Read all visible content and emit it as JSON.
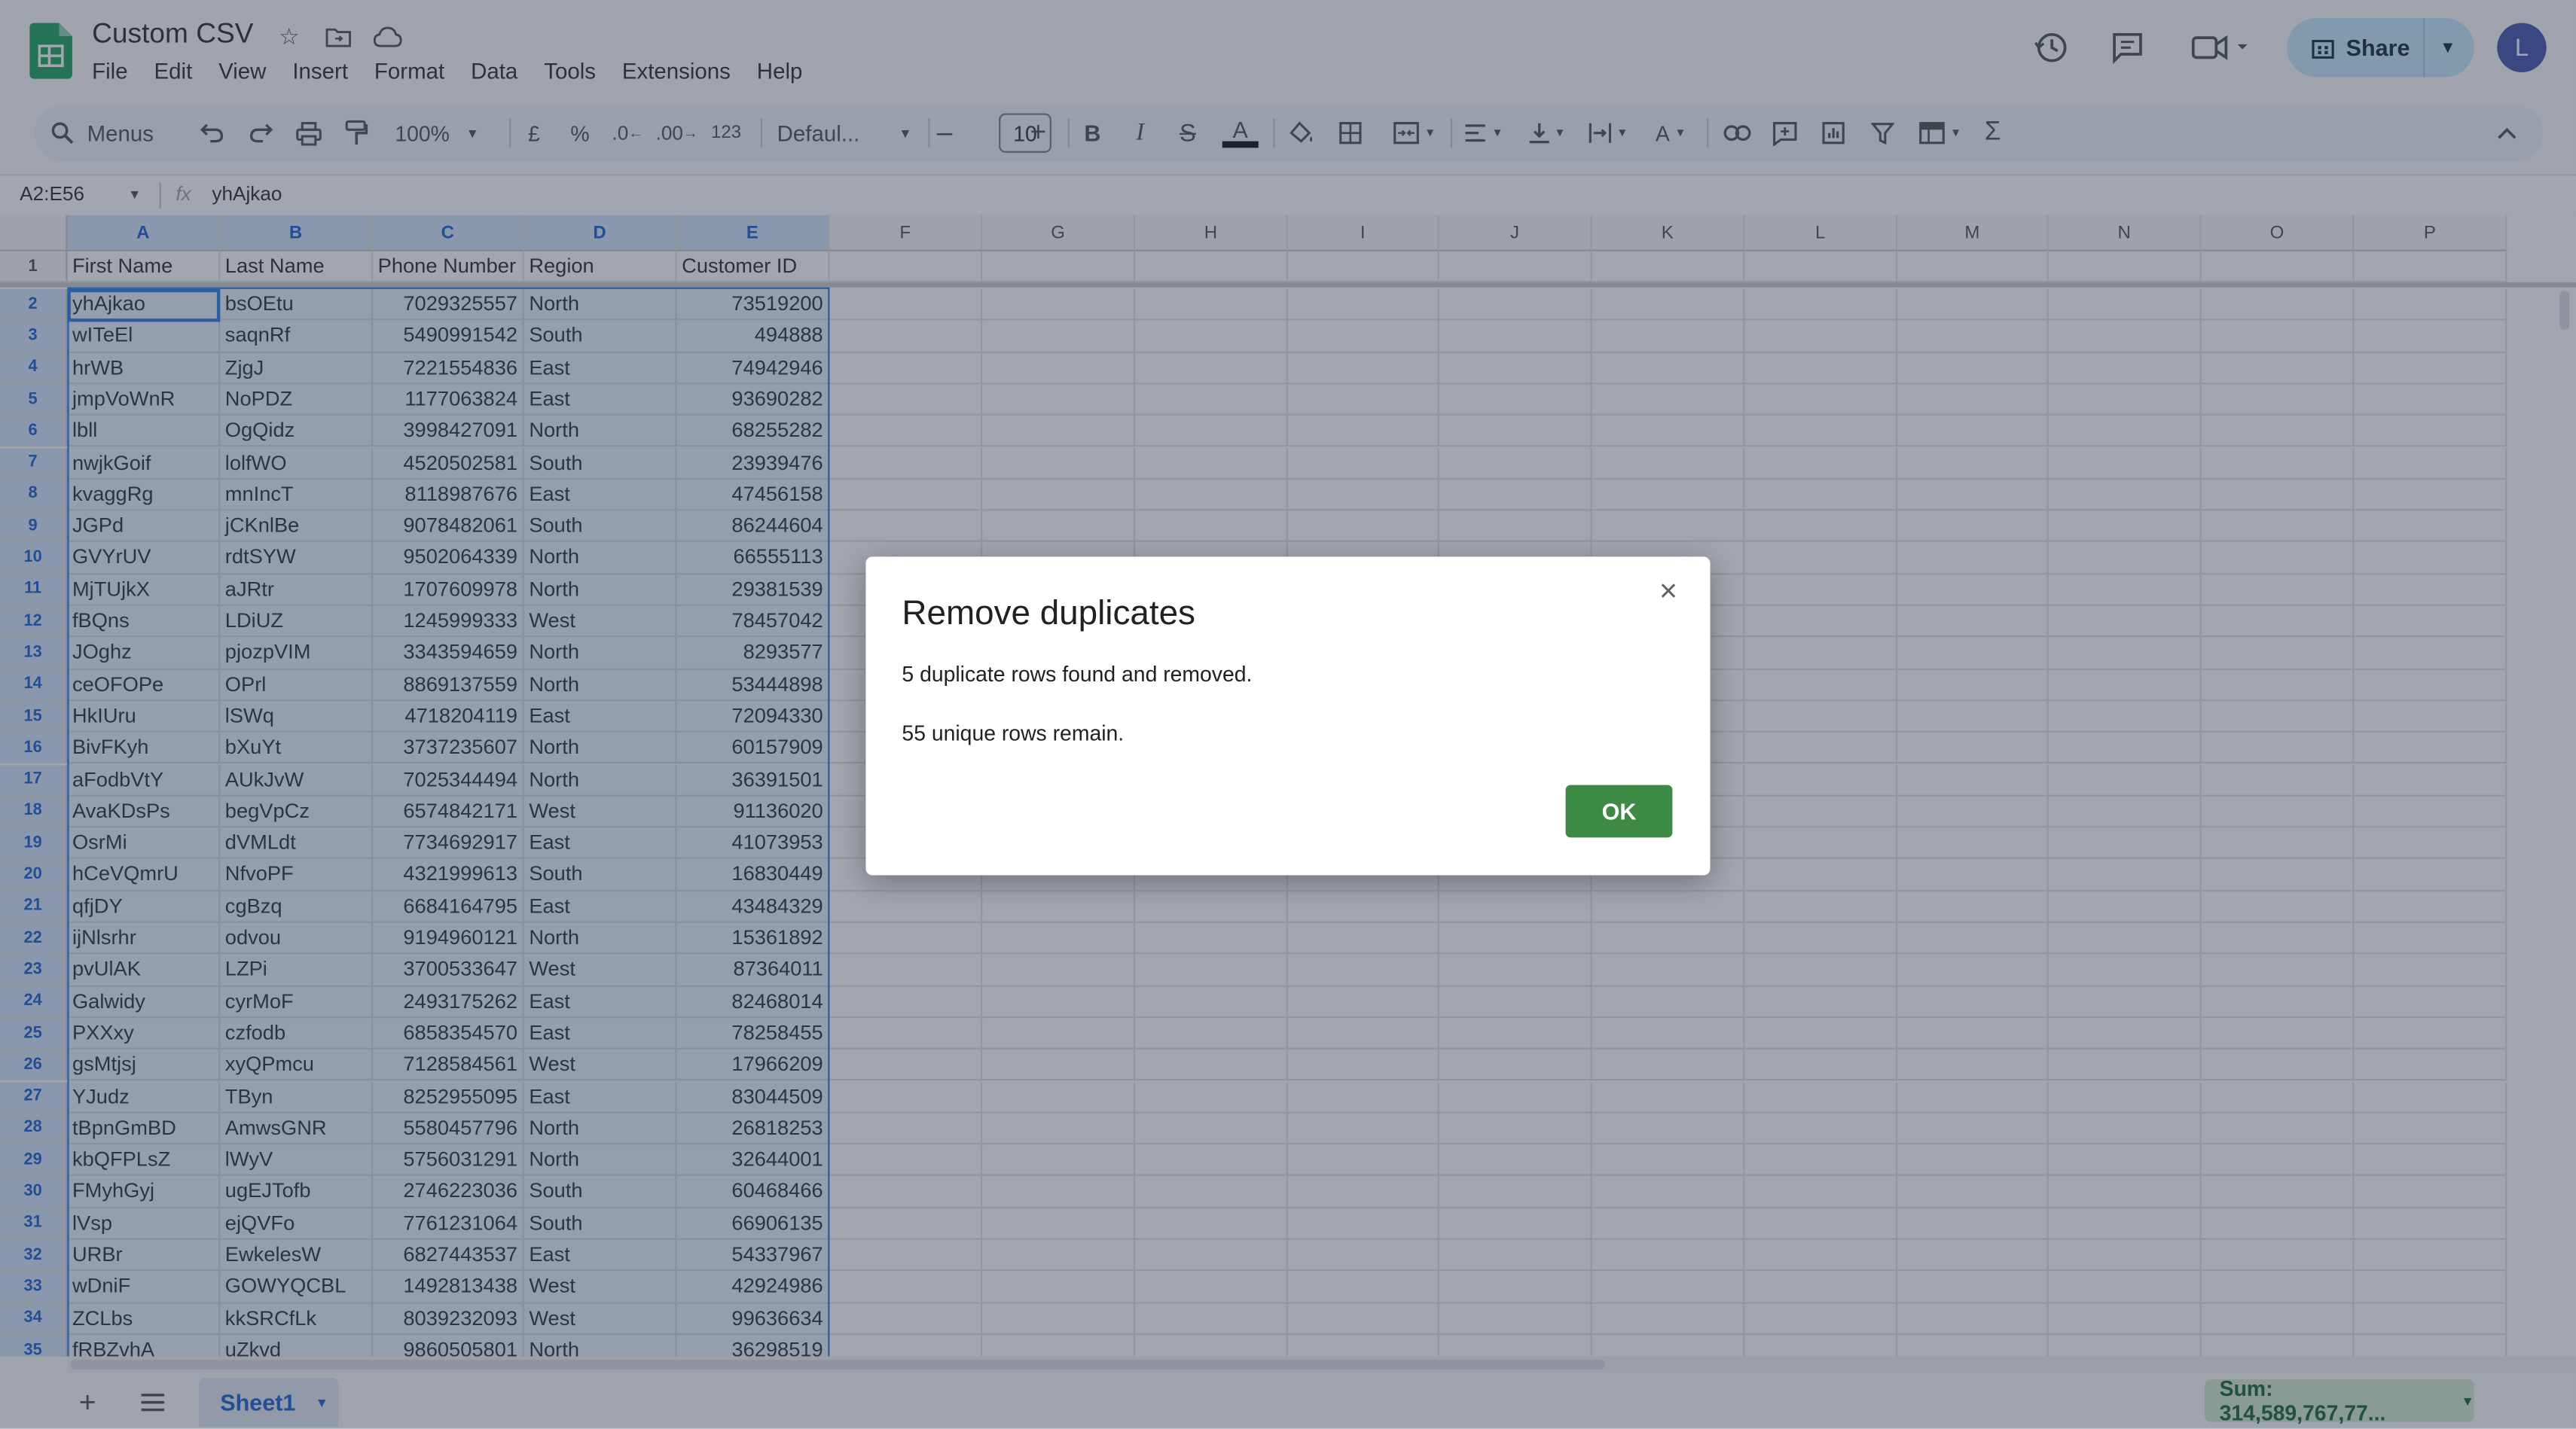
{
  "app": {
    "doc_title": "Custom CSV",
    "menus": [
      "File",
      "Edit",
      "View",
      "Insert",
      "Format",
      "Data",
      "Tools",
      "Extensions",
      "Help"
    ],
    "share_label": "Share",
    "avatar_initial": "L",
    "accent": "#0b57d0"
  },
  "toolbar": {
    "search_label": "Menus",
    "zoom": "100%",
    "currency": "£",
    "percent": "%",
    "dec_decrease": ".0",
    "dec_increase": ".00",
    "format_123": "123",
    "font": "Defaul...",
    "font_size": "10",
    "bold": "B",
    "italic": "I",
    "strike": "S",
    "text_color": "A"
  },
  "formula_bar": {
    "name_box": "A2:E56",
    "fx": "fx",
    "value": "yhAjkao"
  },
  "grid": {
    "columns": [
      "A",
      "B",
      "C",
      "D",
      "E",
      "F",
      "G",
      "H",
      "I",
      "J",
      "K",
      "L",
      "M",
      "N",
      "O",
      "P"
    ],
    "header_row": [
      "First Name",
      "Last Name",
      "Phone Number",
      "Region",
      "Customer ID"
    ],
    "rows": [
      [
        "2",
        "yhAjkao",
        "bsOEtu",
        "7029325557",
        "North",
        "73519200"
      ],
      [
        "3",
        "wITeEl",
        "saqnRf",
        "5490991542",
        "South",
        "494888"
      ],
      [
        "4",
        "hrWB",
        "ZjgJ",
        "7221554836",
        "East",
        "74942946"
      ],
      [
        "5",
        "jmpVoWnR",
        "NoPDZ",
        "1177063824",
        "East",
        "93690282"
      ],
      [
        "6",
        "lbll",
        "OgQidz",
        "3998427091",
        "North",
        "68255282"
      ],
      [
        "7",
        "nwjkGoif",
        "lolfWO",
        "4520502581",
        "South",
        "23939476"
      ],
      [
        "8",
        "kvaggRg",
        "mnIncT",
        "8118987676",
        "East",
        "47456158"
      ],
      [
        "9",
        "JGPd",
        "jCKnlBe",
        "9078482061",
        "South",
        "86244604"
      ],
      [
        "10",
        "GVYrUV",
        "rdtSYW",
        "9502064339",
        "North",
        "66555113"
      ],
      [
        "11",
        "MjTUjkX",
        "aJRtr",
        "1707609978",
        "North",
        "29381539"
      ],
      [
        "12",
        "fBQns",
        "LDiUZ",
        "1245999333",
        "West",
        "78457042"
      ],
      [
        "13",
        "JOghz",
        "pjozpVIM",
        "3343594659",
        "North",
        "8293577"
      ],
      [
        "14",
        "ceOFOPe",
        "OPrl",
        "8869137559",
        "North",
        "53444898"
      ],
      [
        "15",
        "HkIUru",
        "lSWq",
        "4718204119",
        "East",
        "72094330"
      ],
      [
        "16",
        "BivFKyh",
        "bXuYt",
        "3737235607",
        "North",
        "60157909"
      ],
      [
        "17",
        "aFodbVtY",
        "AUkJvW",
        "7025344494",
        "North",
        "36391501"
      ],
      [
        "18",
        "AvaKDsPs",
        "begVpCz",
        "6574842171",
        "West",
        "91136020"
      ],
      [
        "19",
        "OsrMi",
        "dVMLdt",
        "7734692917",
        "East",
        "41073953"
      ],
      [
        "20",
        "hCeVQmrU",
        "NfvoPF",
        "4321999613",
        "South",
        "16830449"
      ],
      [
        "21",
        "qfjDY",
        "cgBzq",
        "6684164795",
        "East",
        "43484329"
      ],
      [
        "22",
        "ijNlsrhr",
        "odvou",
        "9194960121",
        "North",
        "15361892"
      ],
      [
        "23",
        "pvUlAK",
        "LZPi",
        "3700533647",
        "West",
        "87364011"
      ],
      [
        "24",
        "Galwidy",
        "cyrMoF",
        "2493175262",
        "East",
        "82468014"
      ],
      [
        "25",
        "PXXxy",
        "czfodb",
        "6858354570",
        "East",
        "78258455"
      ],
      [
        "26",
        "gsMtjsj",
        "xyQPmcu",
        "7128584561",
        "West",
        "17966209"
      ],
      [
        "27",
        "YJudz",
        "TByn",
        "8252955095",
        "East",
        "83044509"
      ],
      [
        "28",
        "tBpnGmBD",
        "AmwsGNR",
        "5580457796",
        "North",
        "26818253"
      ],
      [
        "29",
        "kbQFPLsZ",
        "lWyV",
        "5756031291",
        "North",
        "32644001"
      ],
      [
        "30",
        "FMyhGyj",
        "ugEJTofb",
        "2746223036",
        "South",
        "60468466"
      ],
      [
        "31",
        "lVsp",
        "ejQVFo",
        "7761231064",
        "South",
        "66906135"
      ],
      [
        "32",
        "URBr",
        "EwkelesW",
        "6827443537",
        "East",
        "54337967"
      ],
      [
        "33",
        "wDniF",
        "GOWYQCBL",
        "1492813438",
        "West",
        "42924986"
      ],
      [
        "34",
        "ZCLbs",
        "kkSRCfLk",
        "8039232093",
        "West",
        "99636634"
      ],
      [
        "35",
        "fRBZvhA",
        "uZkvd",
        "9860505801",
        "North",
        "36298519"
      ]
    ]
  },
  "bottom": {
    "sheet_name": "Sheet1",
    "sum_label": "Sum: 314,589,767,77..."
  },
  "dialog": {
    "title": "Remove duplicates",
    "line1": "5 duplicate rows found and removed.",
    "line2": "55 unique rows remain.",
    "ok_label": "OK",
    "close_glyph": "×"
  }
}
